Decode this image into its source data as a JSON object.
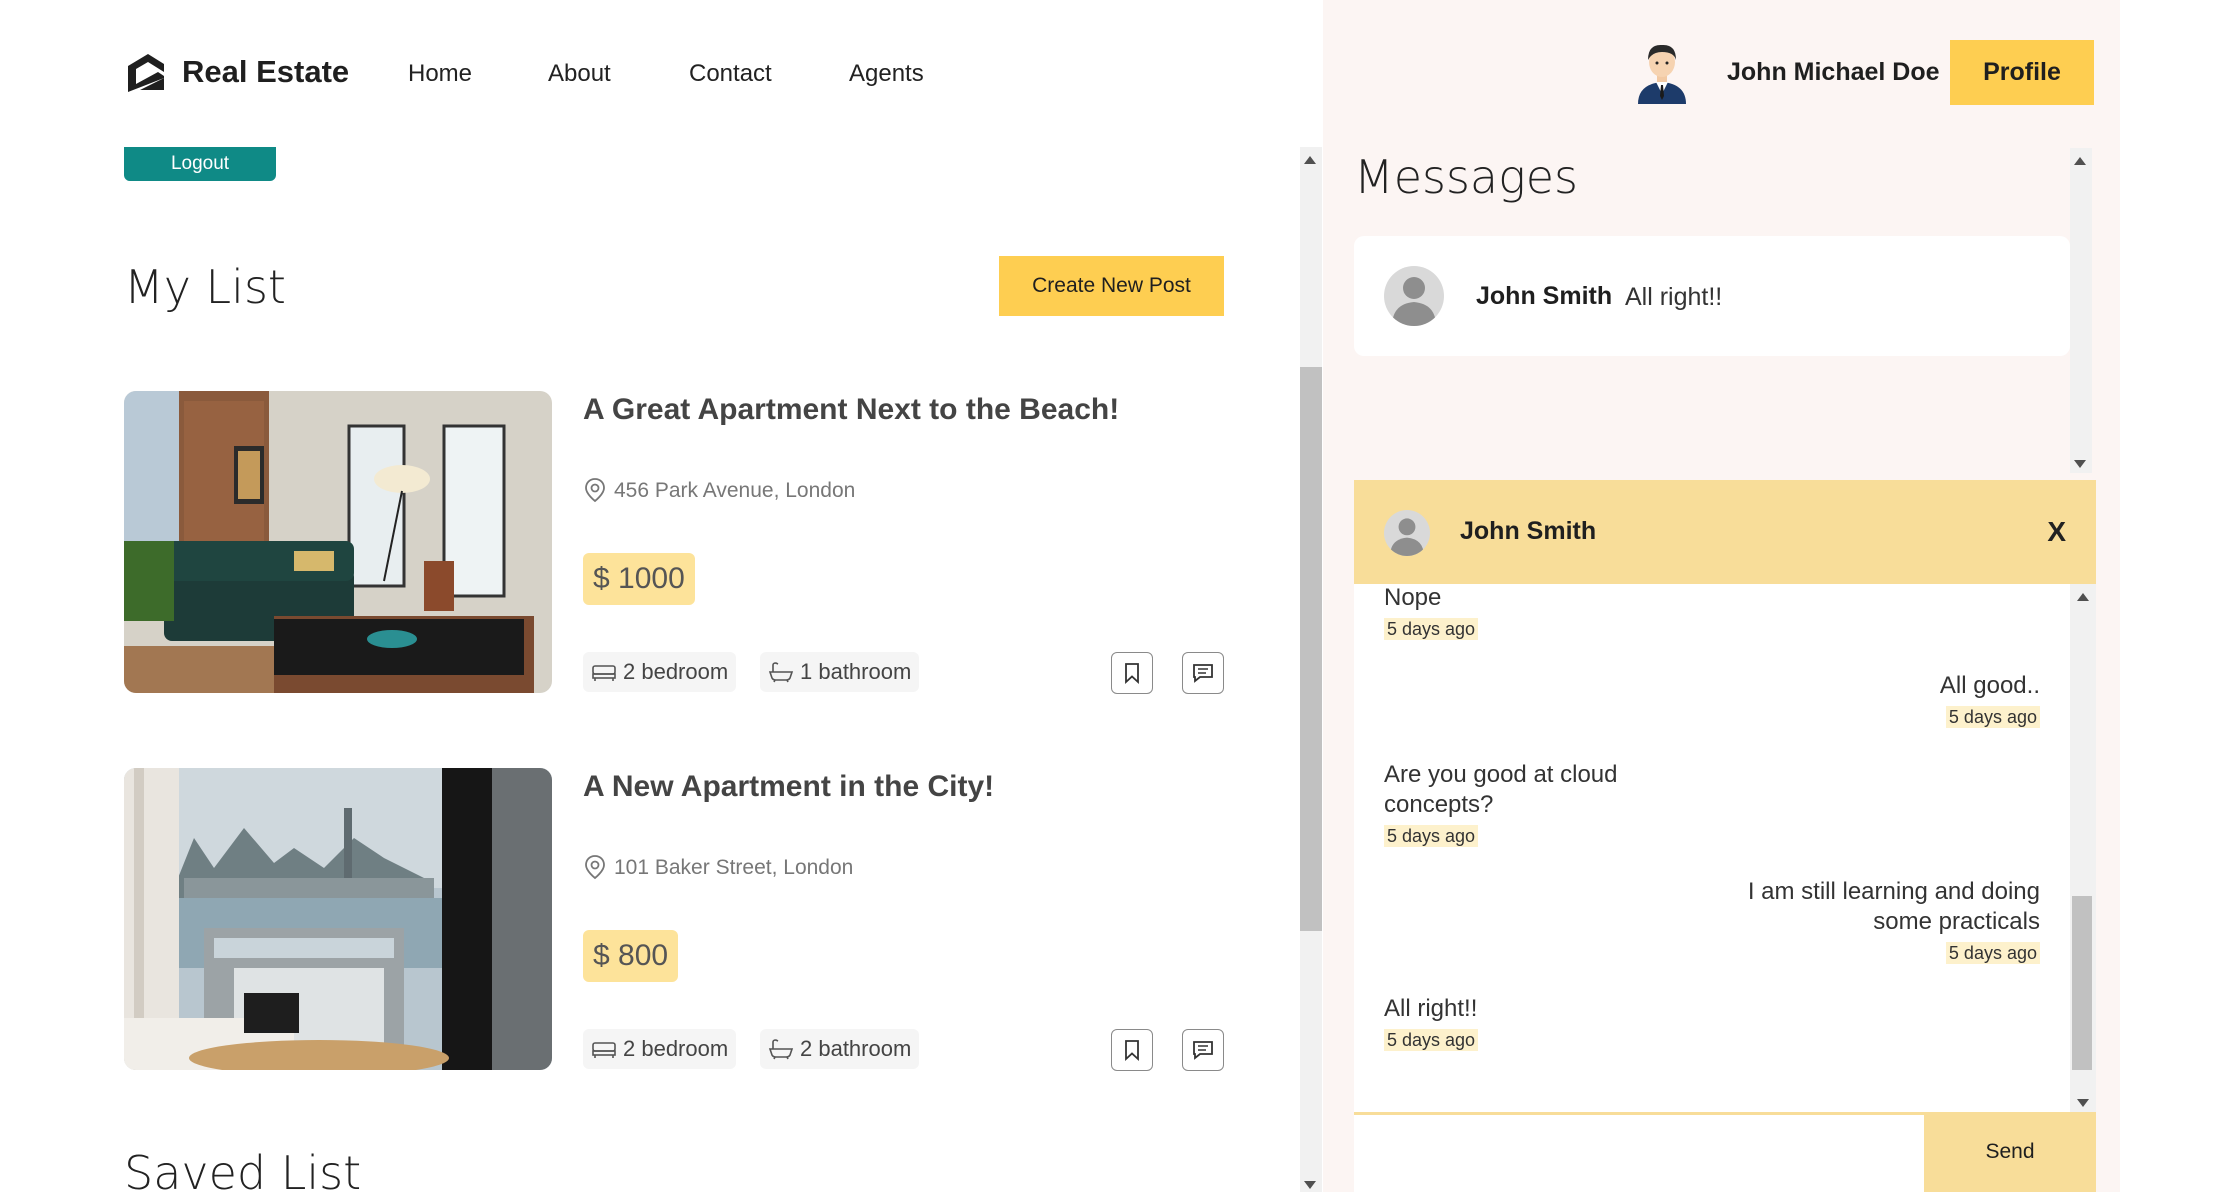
{
  "nav": {
    "brand": "Real Estate",
    "links": [
      "Home",
      "About",
      "Contact",
      "Agents"
    ],
    "user_name": "John Michael Doe",
    "profile_label": "Profile"
  },
  "account": {
    "logout_label": "Logout"
  },
  "my_list": {
    "title": "My List",
    "create_label": "Create New Post",
    "posts": [
      {
        "title": "A Great Apartment Next to the Beach!",
        "address": "456 Park Avenue, London",
        "price": "$ 1000",
        "bedroom": "2 bedroom",
        "bathroom": "1 bathroom"
      },
      {
        "title": "A New Apartment in the City!",
        "address": "101 Baker Street, London",
        "price": "$ 800",
        "bedroom": "2 bedroom",
        "bathroom": "2 bathroom"
      }
    ]
  },
  "saved_list": {
    "title": "Saved List"
  },
  "messages": {
    "title": "Messages",
    "items": [
      {
        "name": "John Smith",
        "last": "All right!!"
      }
    ]
  },
  "chat": {
    "with": "John Smith",
    "close_label": "X",
    "messages": [
      {
        "text": "Nope",
        "time": "5 days ago",
        "side": "left"
      },
      {
        "text": "All good..",
        "time": "5 days ago",
        "side": "right"
      },
      {
        "text": "Are you good at cloud concepts?",
        "time": "5 days ago",
        "side": "left"
      },
      {
        "text": "I am still learning and doing some practicals",
        "time": "5 days ago",
        "side": "right"
      },
      {
        "text": "All right!!",
        "time": "5 days ago",
        "side": "left"
      }
    ],
    "input_value": "",
    "send_label": "Send"
  },
  "colors": {
    "accent": "#fece51",
    "chat_header": "#f8dd99",
    "logout": "#0f8a86",
    "panel_bg": "#fcf5f3"
  }
}
